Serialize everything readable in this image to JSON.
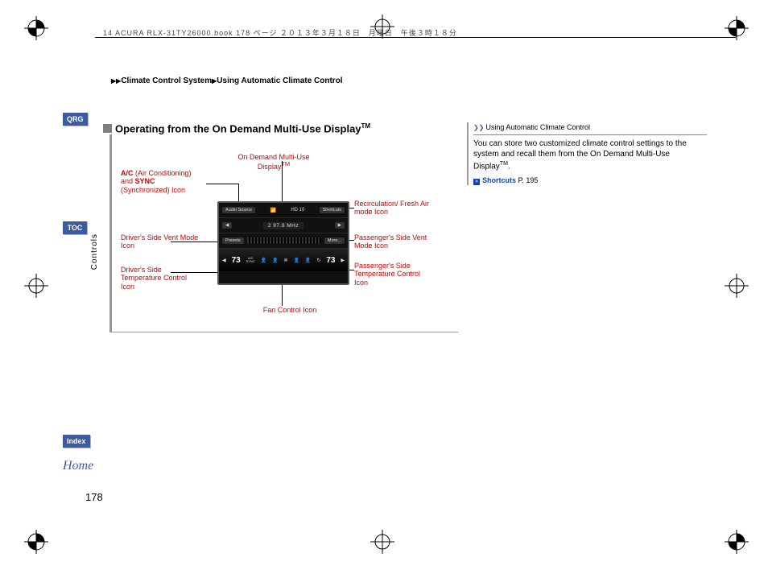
{
  "header_line": "14 ACURA RLX-31TY26000.book  178 ページ  ２０１３年３月１８日　月曜日　午後３時１８分",
  "breadcrumb": {
    "section1": "Climate Control System",
    "section2": "Using Automatic Climate Control"
  },
  "nav": {
    "qrg": "QRG",
    "toc": "TOC",
    "index": "Index",
    "home": "Home"
  },
  "side_section": "Controls",
  "figure": {
    "title": "Operating from the On Demand Multi-Use Display",
    "title_tm": "TM",
    "top_label": "On Demand Multi-Use Display",
    "top_label_tm": "TM",
    "callouts": {
      "ac_sync": "A/C (Air Conditioning) and SYNC (Synchronized) Icon",
      "ac_bold": "A/C",
      "sync_bold": "SYNC",
      "recirc": "Recirculation/ Fresh Air mode Icon",
      "driver_vent": "Driver's Side Vent Mode Icon",
      "pass_vent": "Passenger's Side Vent Mode Icon",
      "driver_temp": "Driver's Side Temperature Control Icon",
      "pass_temp": "Passenger's Side Temperature Control Icon",
      "fan": "Fan Control Icon"
    }
  },
  "device": {
    "row1": {
      "left": "Audio Source",
      "mid_icon": "broadcast",
      "mid_text": "HD 10",
      "right": "Shortcuts"
    },
    "row2": {
      "left": "◀",
      "mid": "2   97.9 MHz",
      "right": "▶"
    },
    "row3": {
      "left": "Presets",
      "right": "More..."
    },
    "climate": {
      "temp_left_dir": "◀",
      "temp_left": "73",
      "icons": [
        "A/C SYNC",
        "vent",
        "vent",
        "fan",
        "vent",
        "vent",
        "recirc"
      ],
      "temp_right": "73",
      "temp_right_dir": "▶"
    }
  },
  "sidebar": {
    "header": "Using Automatic Climate Control",
    "body": "You can store two customized climate control settings to the system and recall them from the On Demand Multi-Use Display",
    "body_tm": "TM",
    "body_end": ".",
    "link_label": "Shortcuts",
    "link_page": "P. 195"
  },
  "page_number": "178"
}
